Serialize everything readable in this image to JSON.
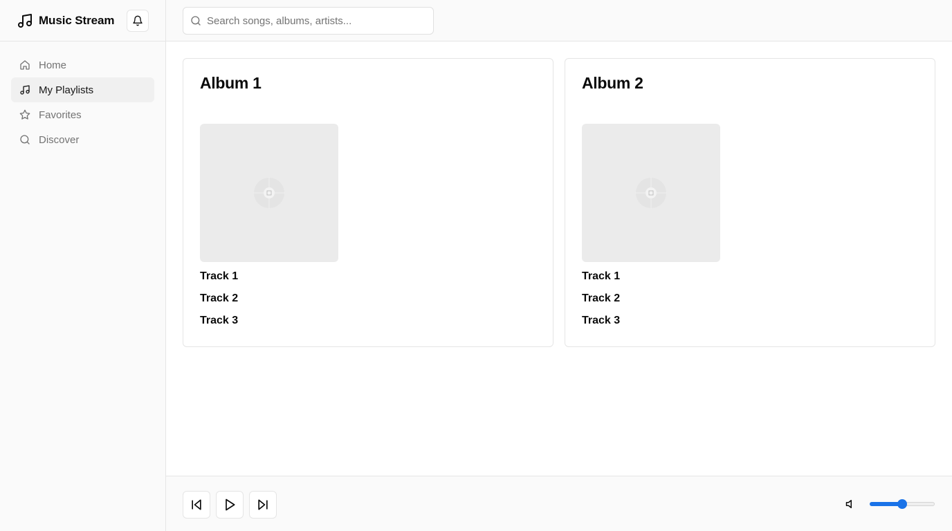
{
  "app": {
    "title": "Music Stream",
    "accent_color": "#1a73e8"
  },
  "sidebar": {
    "items": [
      {
        "label": "Home",
        "icon": "home-icon",
        "active": false
      },
      {
        "label": "My Playlists",
        "icon": "music-note-icon",
        "active": true
      },
      {
        "label": "Favorites",
        "icon": "star-icon",
        "active": false
      },
      {
        "label": "Discover",
        "icon": "search-icon",
        "active": false
      }
    ]
  },
  "search": {
    "placeholder": "Search songs, albums, artists...",
    "value": ""
  },
  "albums": [
    {
      "title": "Album 1",
      "tracks": [
        "Track 1",
        "Track 2",
        "Track 3"
      ]
    },
    {
      "title": "Album 2",
      "tracks": [
        "Track 1",
        "Track 2",
        "Track 3"
      ]
    }
  ],
  "player": {
    "volume": 0.5,
    "controls": [
      "skip-back-icon",
      "play-icon",
      "skip-forward-icon"
    ]
  }
}
